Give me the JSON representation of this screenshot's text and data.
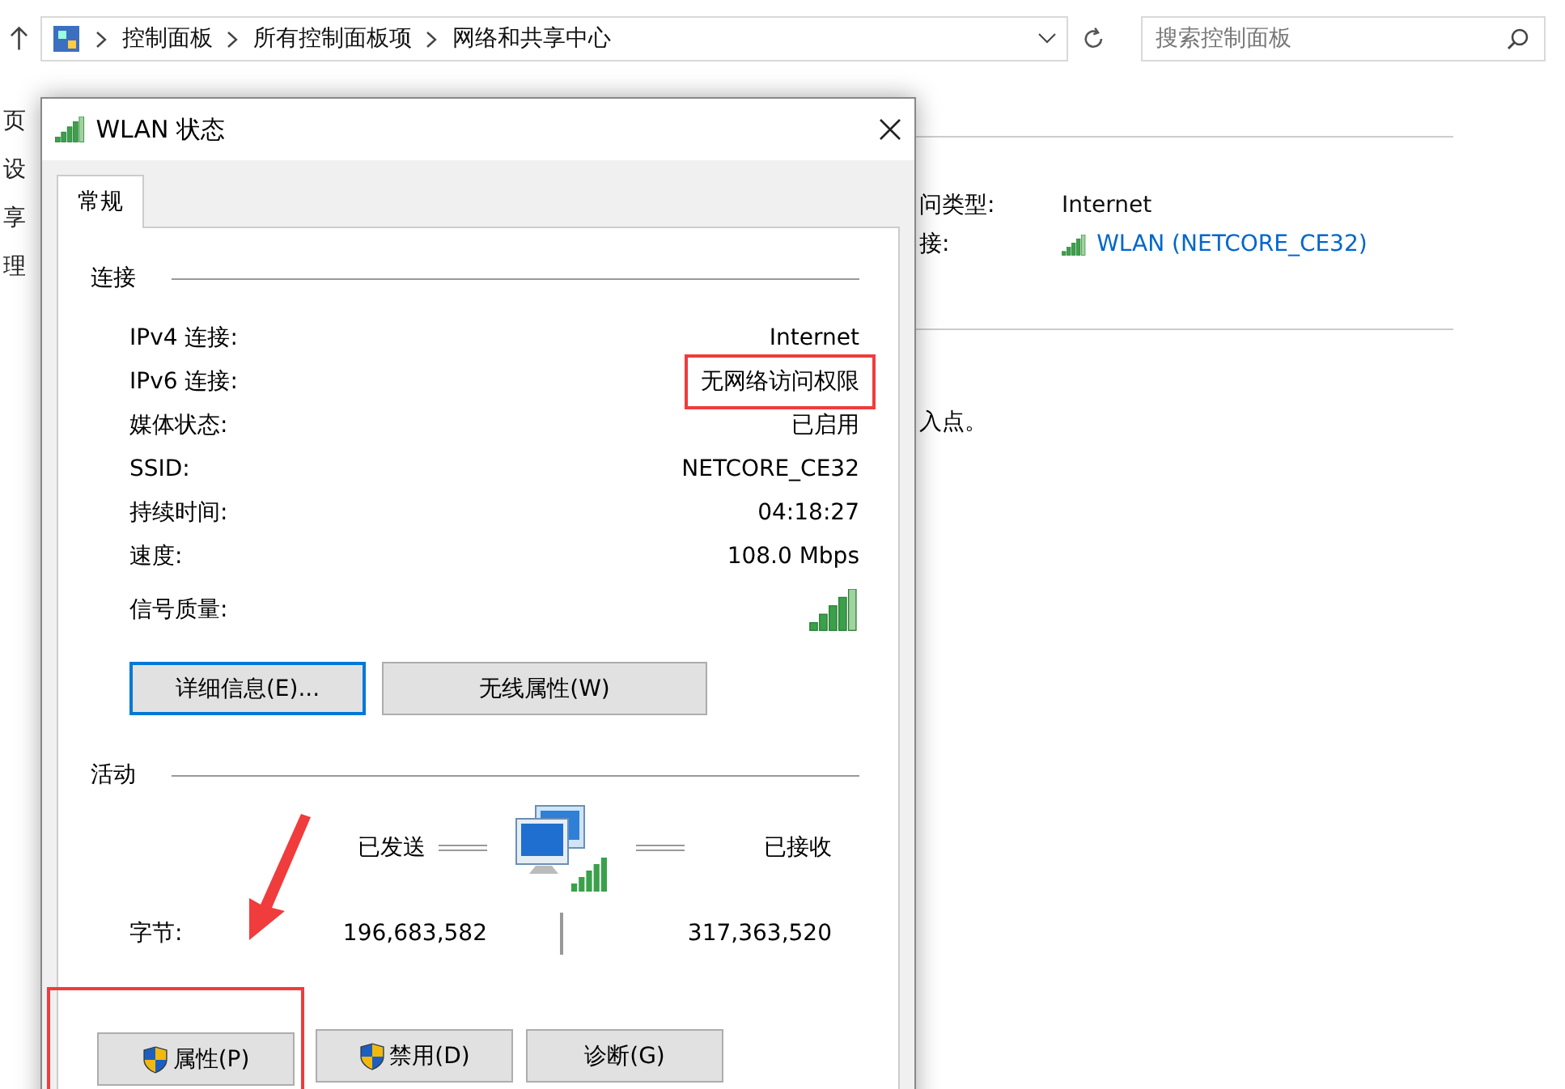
{
  "address_bar": {
    "breadcrumbs": [
      "控制面板",
      "所有控制面板项",
      "网络和共享中心"
    ],
    "search": {
      "placeholder": "搜索控制面板"
    }
  },
  "background": {
    "sidebar_items": [
      "页",
      "设",
      "享",
      "理"
    ],
    "details": [
      {
        "label": "问类型:",
        "value": "Internet",
        "kind": "text"
      },
      {
        "label": "接:",
        "value": "WLAN (NETCORE_CE32)",
        "kind": "link"
      }
    ],
    "note": "入点。"
  },
  "dialog": {
    "title": "WLAN 状态",
    "tabs": [
      {
        "label": "常规",
        "selected": true
      }
    ],
    "connection": {
      "heading": "连接",
      "rows": [
        {
          "label": "IPv4 连接:",
          "value": "Internet",
          "annotated": false
        },
        {
          "label": "IPv6 连接:",
          "value": "无网络访问权限",
          "annotated": true
        },
        {
          "label": "媒体状态:",
          "value": "已启用",
          "annotated": false
        },
        {
          "label": "SSID:",
          "value": "NETCORE_CE32",
          "annotated": false
        },
        {
          "label": "持续时间:",
          "value": "04:18:27",
          "annotated": false
        },
        {
          "label": "速度:",
          "value": "108.0 Mbps",
          "annotated": false
        }
      ],
      "signal_label": "信号质量:",
      "buttons": [
        {
          "label": "详细信息(E)...",
          "focused": true
        },
        {
          "label": "无线属性(W)",
          "focused": false
        }
      ]
    },
    "activity": {
      "heading": "活动",
      "sent_label": "已发送",
      "received_label": "已接收",
      "bytes_label": "字节:",
      "sent": "196,683,582",
      "received": "317,363,520"
    },
    "buttons": [
      {
        "label": "属性(P)",
        "shield": true,
        "annotated": true
      },
      {
        "label": "禁用(D)",
        "shield": true,
        "annotated": false
      },
      {
        "label": "诊断(G)",
        "shield": false,
        "annotated": false
      }
    ]
  }
}
